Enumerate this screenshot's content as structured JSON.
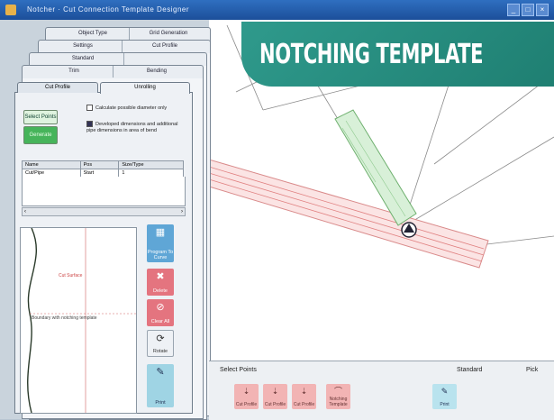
{
  "window": {
    "title": "Notcher · Cut Connection Template Designer",
    "controls": [
      "_",
      "□",
      "×"
    ]
  },
  "banner": {
    "text": "NOTCHING TEMPLATE"
  },
  "panel": {
    "tab_rows": [
      [
        "Object Type",
        "Grid Generation"
      ],
      [
        "Settings",
        "Cut Profile"
      ],
      [
        "Standard"
      ],
      [
        "Trim",
        "Bending"
      ],
      [
        "Cut Profile",
        "Unrolling"
      ]
    ],
    "front_tabs": [
      "Cut Profile",
      "Unrolling"
    ],
    "buttons": {
      "select_points": "Select Points",
      "generate": "Generate"
    },
    "checkboxes": [
      {
        "label": "Calculate possible diameter only",
        "checked": false
      },
      {
        "label": "Developed dimensions and additional pipe dimensions in area of bend",
        "checked": true
      }
    ],
    "table": {
      "headers": [
        "Name",
        "Pos",
        "Size/Type"
      ],
      "rows": [
        [
          "Cut/Pipe",
          "Start",
          "1"
        ]
      ]
    },
    "profile": {
      "annotation_1": "Cut Surface",
      "annotation_2": "Boundary with notching template"
    },
    "side_buttons": [
      {
        "label": "Program To Curve",
        "icon": "program-icon",
        "color": "#5fa6d6"
      },
      {
        "label": "Delete",
        "icon": "delete-icon",
        "color": "#e4747f"
      },
      {
        "label": "Clear All",
        "icon": "clear-icon",
        "color": "#e4747f"
      },
      {
        "label": "Rotate",
        "icon": "rotate-icon",
        "color": "#eef1f5"
      },
      {
        "label": "Print",
        "icon": "print-icon",
        "color": "#9fd4e4"
      }
    ]
  },
  "bottom_bar": {
    "label_left": "Select Points",
    "label_right_1": "Standard",
    "label_right_2": "Pick",
    "tools": [
      {
        "label": "Cut Profile",
        "color": "#f2b4b4"
      },
      {
        "label": "Cut Profile",
        "color": "#f2b4b4"
      },
      {
        "label": "Cut Profile",
        "color": "#f2b4b4"
      },
      {
        "label": "Notching Template",
        "color": "#f2b4b4"
      },
      {
        "label": "Print",
        "color": "#b9e3ee"
      }
    ]
  }
}
